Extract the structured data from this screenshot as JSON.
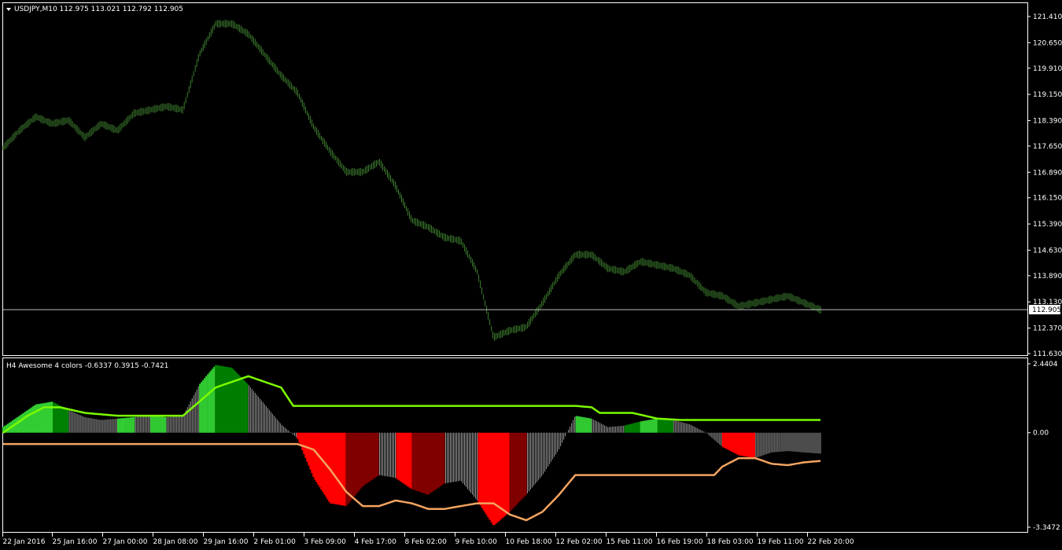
{
  "main_panel": {
    "title": "USDJPY,M10  112.975 113.021 112.792 112.905",
    "price_tag": "112.905",
    "price_color": "#3e7f2f",
    "y_ticks": [
      "121.410",
      "120.650",
      "119.910",
      "119.150",
      "118.390",
      "117.650",
      "116.890",
      "116.150",
      "115.390",
      "114.630",
      "113.890",
      "113.130",
      "112.370",
      "111.630"
    ]
  },
  "indicator_panel": {
    "title": "H4 Awesome 4 colors -0.6337 0.3915 -0.7421",
    "y_ticks": [
      "2.4404",
      "0.00",
      "-3.3472"
    ],
    "colors": {
      "up_bright": "#32cd32",
      "up_dark": "#008000",
      "down_bright": "#ff0000",
      "down_dark": "#800000",
      "neutral": "#c0c0c0",
      "upper_line": "#7cfc00",
      "lower_line": "#f4a460"
    }
  },
  "x_ticks": [
    "22 Jan 2016",
    "25 Jan 16:00",
    "27 Jan 00:00",
    "28 Jan 08:00",
    "29 Jan 16:00",
    "2 Feb 01:00",
    "3 Feb 09:00",
    "4 Feb 17:00",
    "8 Feb 02:00",
    "9 Feb 10:00",
    "10 Feb 18:00",
    "12 Feb 02:00",
    "15 Feb 11:00",
    "16 Feb 19:00",
    "18 Feb 03:00",
    "19 Feb 11:00",
    "22 Feb 20:00"
  ],
  "chart_data": [
    {
      "type": "line",
      "series": [
        {
          "name": "USDJPY,M10",
          "x": [
            0,
            2,
            4,
            6,
            8,
            10,
            12,
            14,
            16,
            18,
            20,
            22,
            24,
            26,
            28,
            30,
            32,
            34,
            36,
            38,
            40,
            42,
            44,
            46,
            48,
            50,
            52,
            54,
            56,
            58,
            60,
            62,
            64,
            66,
            68,
            70,
            72,
            74,
            76,
            78,
            80,
            82,
            84,
            86,
            88,
            90,
            92,
            94,
            96,
            98,
            100
          ],
          "values": [
            117.6,
            118.1,
            118.5,
            118.3,
            118.4,
            117.9,
            118.3,
            118.1,
            118.6,
            118.7,
            118.8,
            118.7,
            120.3,
            121.2,
            121.2,
            120.9,
            120.3,
            119.7,
            119.2,
            118.2,
            117.5,
            116.9,
            116.9,
            117.2,
            116.5,
            115.5,
            115.3,
            115.0,
            114.9,
            114.0,
            112.1,
            112.3,
            112.4,
            113.1,
            113.9,
            114.5,
            114.5,
            114.1,
            114.0,
            114.3,
            114.2,
            114.1,
            113.9,
            113.4,
            113.3,
            113.0,
            113.1,
            113.2,
            113.3,
            113.1,
            112.9
          ],
          "color": "#3e7f2f"
        }
      ],
      "ylim": [
        111.45,
        121.85
      ],
      "current_price": 112.905
    },
    {
      "type": "bar",
      "series": [
        {
          "name": "Awesome",
          "x": [
            0,
            2,
            4,
            6,
            8,
            10,
            12,
            14,
            16,
            18,
            20,
            22,
            24,
            26,
            28,
            30,
            32,
            34,
            36,
            38,
            40,
            42,
            44,
            46,
            48,
            50,
            52,
            54,
            56,
            58,
            60,
            62,
            64,
            66,
            68,
            70,
            72,
            74,
            76,
            78,
            80,
            82,
            84,
            86,
            88,
            90,
            92,
            94,
            96,
            98,
            100
          ],
          "values": [
            0.2,
            0.6,
            1.0,
            1.1,
            0.8,
            0.55,
            0.45,
            0.5,
            0.55,
            0.6,
            0.55,
            0.6,
            1.7,
            2.4,
            2.3,
            1.7,
            1.0,
            0.3,
            -0.2,
            -1.6,
            -2.5,
            -2.6,
            -1.9,
            -1.5,
            -1.6,
            -2.0,
            -2.2,
            -1.8,
            -1.7,
            -2.4,
            -3.3,
            -2.8,
            -2.2,
            -1.5,
            -0.6,
            0.6,
            0.5,
            0.2,
            0.25,
            0.4,
            0.5,
            0.45,
            0.3,
            0.0,
            -0.5,
            -0.8,
            -0.9,
            -0.7,
            -0.65,
            -0.7,
            -0.74
          ],
          "colors": [
            "up_bright",
            "up_bright",
            "up_bright",
            "up_dark",
            "neutral",
            "neutral",
            "neutral",
            "up_bright",
            "neutral",
            "up_bright",
            "neutral",
            "neutral",
            "up_bright",
            "up_dark",
            "up_dark",
            "neutral",
            "neutral",
            "neutral",
            "down_bright",
            "down_bright",
            "down_bright",
            "down_dark",
            "down_dark",
            "neutral",
            "down_bright",
            "down_dark",
            "down_dark",
            "neutral",
            "neutral",
            "down_bright",
            "down_bright",
            "down_dark",
            "neutral",
            "neutral",
            "neutral",
            "up_bright",
            "neutral",
            "neutral",
            "up_dark",
            "up_bright",
            "up_dark",
            "neutral",
            "neutral",
            "neutral",
            "down_bright",
            "down_bright",
            "neutral",
            "neutral",
            "neutral",
            "neutral",
            "neutral"
          ]
        },
        {
          "name": "upper",
          "x": [
            0,
            3,
            5,
            7,
            10,
            14,
            18,
            22,
            26,
            30,
            34,
            35.5,
            36,
            40,
            50,
            60,
            70,
            72,
            73,
            75,
            77,
            80,
            83,
            90,
            100
          ],
          "values": [
            0.0,
            0.6,
            0.9,
            0.9,
            0.7,
            0.6,
            0.6,
            0.6,
            1.6,
            2.0,
            1.6,
            0.95,
            0.95,
            0.95,
            0.95,
            0.95,
            0.95,
            0.9,
            0.7,
            0.7,
            0.7,
            0.5,
            0.45,
            0.45,
            0.45
          ],
          "color": "#7cfc00"
        },
        {
          "name": "lower",
          "x": [
            0,
            10,
            20,
            30,
            36,
            38,
            40,
            42,
            44,
            46,
            48,
            50,
            52,
            54,
            56,
            58,
            60,
            62,
            64,
            66,
            68,
            70,
            72,
            74,
            76,
            78,
            80,
            82,
            84,
            86,
            87,
            88,
            90,
            92,
            94,
            96,
            98,
            100
          ],
          "values": [
            -0.4,
            -0.4,
            -0.4,
            -0.4,
            -0.4,
            -0.6,
            -1.3,
            -2.1,
            -2.6,
            -2.6,
            -2.4,
            -2.5,
            -2.7,
            -2.7,
            -2.6,
            -2.5,
            -2.5,
            -2.9,
            -3.1,
            -2.8,
            -2.2,
            -1.5,
            -1.5,
            -1.5,
            -1.5,
            -1.5,
            -1.5,
            -1.5,
            -1.5,
            -1.5,
            -1.5,
            -1.2,
            -0.9,
            -0.9,
            -1.1,
            -1.15,
            -1.05,
            -1.0
          ],
          "color": "#f4a460"
        }
      ],
      "ylim": [
        -3.3472,
        2.4404
      ]
    }
  ]
}
